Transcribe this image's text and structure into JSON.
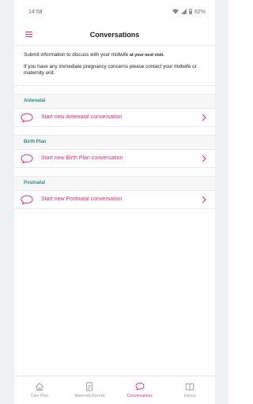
{
  "status": {
    "time": "14:58",
    "battery": "62%"
  },
  "header": {
    "title": "Conversations"
  },
  "intro": {
    "line1": "Submit information to discuss with your midwife ",
    "line1_bold": "at your next visit.",
    "line2": "If you have any immediate pregnancy concerns please contact your midwife or maternity unit."
  },
  "sections": [
    {
      "label": "Antenatal",
      "action": "Start new Antenatal conversation"
    },
    {
      "label": "Birth Plan",
      "action": "Start new Birth Plan conversation"
    },
    {
      "label": "Postnatal",
      "action": "Start new Postnatal conversation"
    }
  ],
  "tabs": [
    {
      "label": "Care Plan",
      "icon": "home-icon"
    },
    {
      "label": "Maternity Record",
      "icon": "document-icon"
    },
    {
      "label": "Conversations",
      "icon": "chat-bubble-icon",
      "active": true
    },
    {
      "label": "Library",
      "icon": "book-icon"
    }
  ],
  "colors": {
    "accent": "#d6337f",
    "section": "#2e8c84"
  }
}
